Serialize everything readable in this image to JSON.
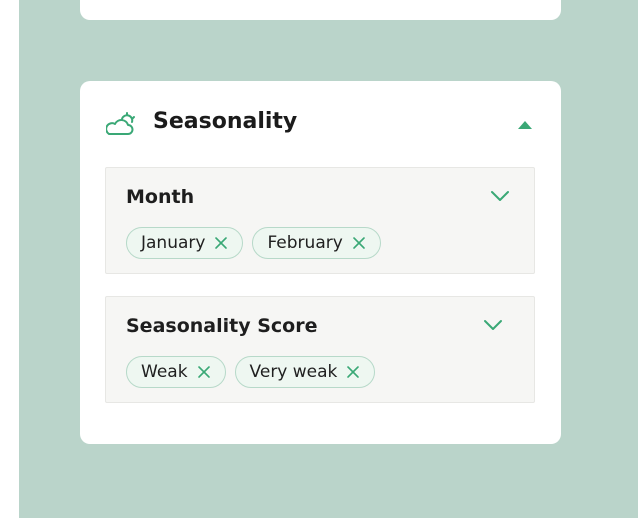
{
  "section": {
    "title": "Seasonality",
    "icon": "cloud-sun-icon",
    "expanded": true
  },
  "filters": {
    "month": {
      "label": "Month",
      "chips": [
        "January",
        "February"
      ]
    },
    "score": {
      "label": "Seasonality Score",
      "chips": [
        "Weak",
        "Very weak"
      ]
    }
  },
  "colors": {
    "background": "#bad4ca",
    "accent": "#3aa876",
    "chip_border": "#b7d9c9",
    "chip_fill": "#eef7f1"
  }
}
